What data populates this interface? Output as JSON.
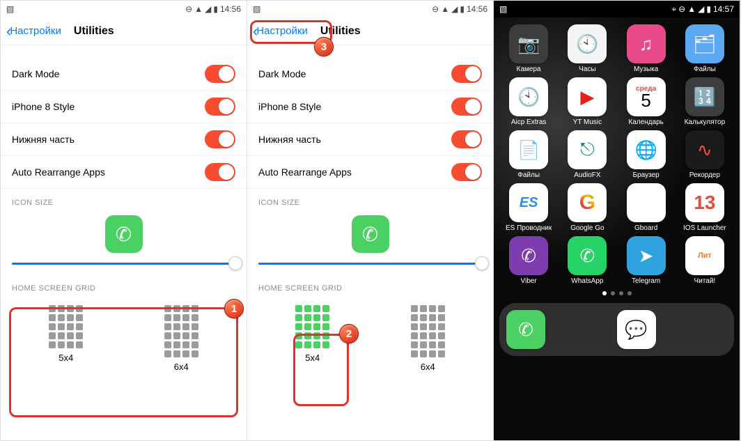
{
  "statusbar": {
    "time1": "14:56",
    "time2": "14:56",
    "time3": "14:57"
  },
  "nav": {
    "back": "Настройки",
    "title": "Utilities"
  },
  "settings": {
    "rows": [
      {
        "label": "Dark Mode"
      },
      {
        "label": "iPhone 8 Style"
      },
      {
        "label": "Нижняя часть"
      },
      {
        "label": "Auto Rearrange Apps"
      }
    ],
    "iconSizeLabel": "ICON SIZE",
    "gridLabel": "HOME SCREEN GRID",
    "gridOptions": {
      "a": "5x4",
      "b": "6x4"
    }
  },
  "badges": {
    "b1": "1",
    "b2": "2",
    "b3": "3"
  },
  "home": {
    "apps": [
      {
        "label": "Камера",
        "cls": "ico-camera",
        "glyph": "📷"
      },
      {
        "label": "Часы",
        "cls": "ico-clock",
        "glyph": "🕙"
      },
      {
        "label": "Музыка",
        "cls": "ico-music",
        "glyph": "♫"
      },
      {
        "label": "Файлы",
        "cls": "ico-files",
        "glyph": "🗂"
      },
      {
        "label": "Aicp Extras",
        "cls": "ico-extras",
        "glyph": "🕙"
      },
      {
        "label": "YT Music",
        "cls": "ico-ytm",
        "glyph": "▶"
      },
      {
        "label": "Календарь",
        "cls": "ico-cal",
        "glyph": "CAL"
      },
      {
        "label": "Калькулятор",
        "cls": "ico-calc",
        "glyph": "🔢"
      },
      {
        "label": "Файлы",
        "cls": "ico-files2",
        "glyph": "📄"
      },
      {
        "label": "AudioFX",
        "cls": "ico-audiofx",
        "glyph": "⎋"
      },
      {
        "label": "Браузер",
        "cls": "ico-browser",
        "glyph": "🌐"
      },
      {
        "label": "Рекордер",
        "cls": "ico-rec",
        "glyph": "∿"
      },
      {
        "label": "ES Проводник",
        "cls": "ico-es",
        "glyph": "ES"
      },
      {
        "label": "Google Go",
        "cls": "ico-ggo",
        "glyph": "G"
      },
      {
        "label": "Gboard",
        "cls": "ico-gboard",
        "glyph": "⌨"
      },
      {
        "label": "IOS Launcher",
        "cls": "ico-ios",
        "glyph": "13"
      },
      {
        "label": "Viber",
        "cls": "ico-viber",
        "glyph": "✆"
      },
      {
        "label": "WhatsApp",
        "cls": "ico-wa",
        "glyph": "✆"
      },
      {
        "label": "Telegram",
        "cls": "ico-tg",
        "glyph": "➤"
      },
      {
        "label": "Читай!",
        "cls": "ico-chitai",
        "glyph": "Лит"
      }
    ],
    "calendar": {
      "weekday": "среда",
      "day": "5"
    },
    "dock": [
      {
        "name": "phone",
        "cls": "ico-phone",
        "glyph": "✆"
      },
      {
        "name": "messages",
        "cls": "ico-msg",
        "glyph": "💬"
      }
    ]
  }
}
